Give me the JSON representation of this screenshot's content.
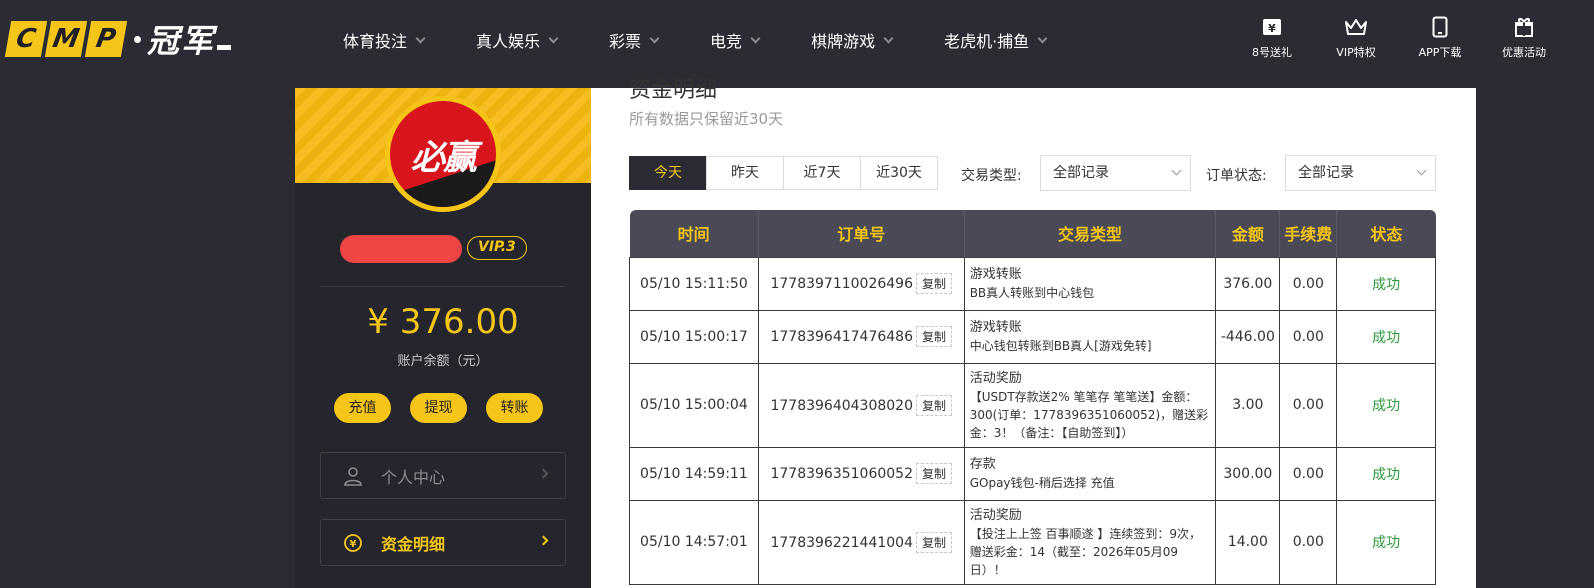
{
  "brand": {
    "logo_letters": [
      "C",
      "M",
      "P"
    ],
    "name": "冠军"
  },
  "nav": {
    "items": [
      {
        "label": "体育投注"
      },
      {
        "label": "真人娱乐"
      },
      {
        "label": "彩票"
      },
      {
        "label": "电竞"
      },
      {
        "label": "棋牌游戏"
      },
      {
        "label": "老虎机·捕鱼"
      }
    ],
    "right": [
      {
        "label": "8号送礼",
        "icon": "ticket-icon"
      },
      {
        "label": "VIP特权",
        "icon": "crown-icon"
      },
      {
        "label": "APP下载",
        "icon": "phone-icon"
      },
      {
        "label": "优惠活动",
        "icon": "gift-icon"
      }
    ]
  },
  "profile": {
    "avatar_text": "必赢",
    "vip": "VIP.3",
    "balance": "¥ 376.00",
    "balance_label": "账户余额（元）",
    "actions": [
      "充值",
      "提现",
      "转账"
    ],
    "menu": [
      {
        "label": "个人中心",
        "icon": "user-icon"
      },
      {
        "label": "资金明细",
        "icon": "money-icon"
      }
    ]
  },
  "page": {
    "title": "资金明细",
    "subtitle": "所有数据只保留近30天",
    "tabs": [
      "今天",
      "昨天",
      "近7天",
      "近30天"
    ],
    "active_tab": 0,
    "filters": {
      "type_label": "交易类型:",
      "type_value": "全部记录",
      "status_label": "订单状态:",
      "status_value": "全部记录"
    }
  },
  "table": {
    "headers": [
      "时间",
      "订单号",
      "交易类型",
      "金额",
      "手续费",
      "状态"
    ],
    "copy_label": "复制",
    "rows": [
      {
        "time": "05/10 15:11:50",
        "order": "1778397110026496",
        "type_title": "游戏转账",
        "type_desc": "BB真人转账到中心钱包",
        "amount": "376.00",
        "fee": "0.00",
        "status": "成功"
      },
      {
        "time": "05/10 15:00:17",
        "order": "1778396417476486",
        "type_title": "游戏转账",
        "type_desc": "中心钱包转账到BB真人[游戏免转]",
        "amount": "-446.00",
        "fee": "0.00",
        "status": "成功"
      },
      {
        "time": "05/10 15:00:04",
        "order": "1778396404308020",
        "type_title": "活动奖励",
        "type_desc": "【USDT存款送2% 笔笔存 笔笔送】金额：300(订单：1778396351060052)，赠送彩金：3！（备注：【自助签到】）",
        "amount": "3.00",
        "fee": "0.00",
        "status": "成功"
      },
      {
        "time": "05/10 14:59:11",
        "order": "1778396351060052",
        "type_title": "存款",
        "type_desc": "GOpay钱包-稍后选择 充值",
        "amount": "300.00",
        "fee": "0.00",
        "status": "成功"
      },
      {
        "time": "05/10 14:57:01",
        "order": "1778396221441004",
        "type_title": "活动奖励",
        "type_desc": "【投注上上签 百事顺遂 】连续签到：9次，赠送彩金：14（截至：2026年05月09日）！",
        "amount": "14.00",
        "fee": "0.00",
        "status": "成功"
      }
    ]
  },
  "colors": {
    "accent": "#f5c518",
    "dark": "#2b2c33",
    "success": "#2e9a3e"
  }
}
